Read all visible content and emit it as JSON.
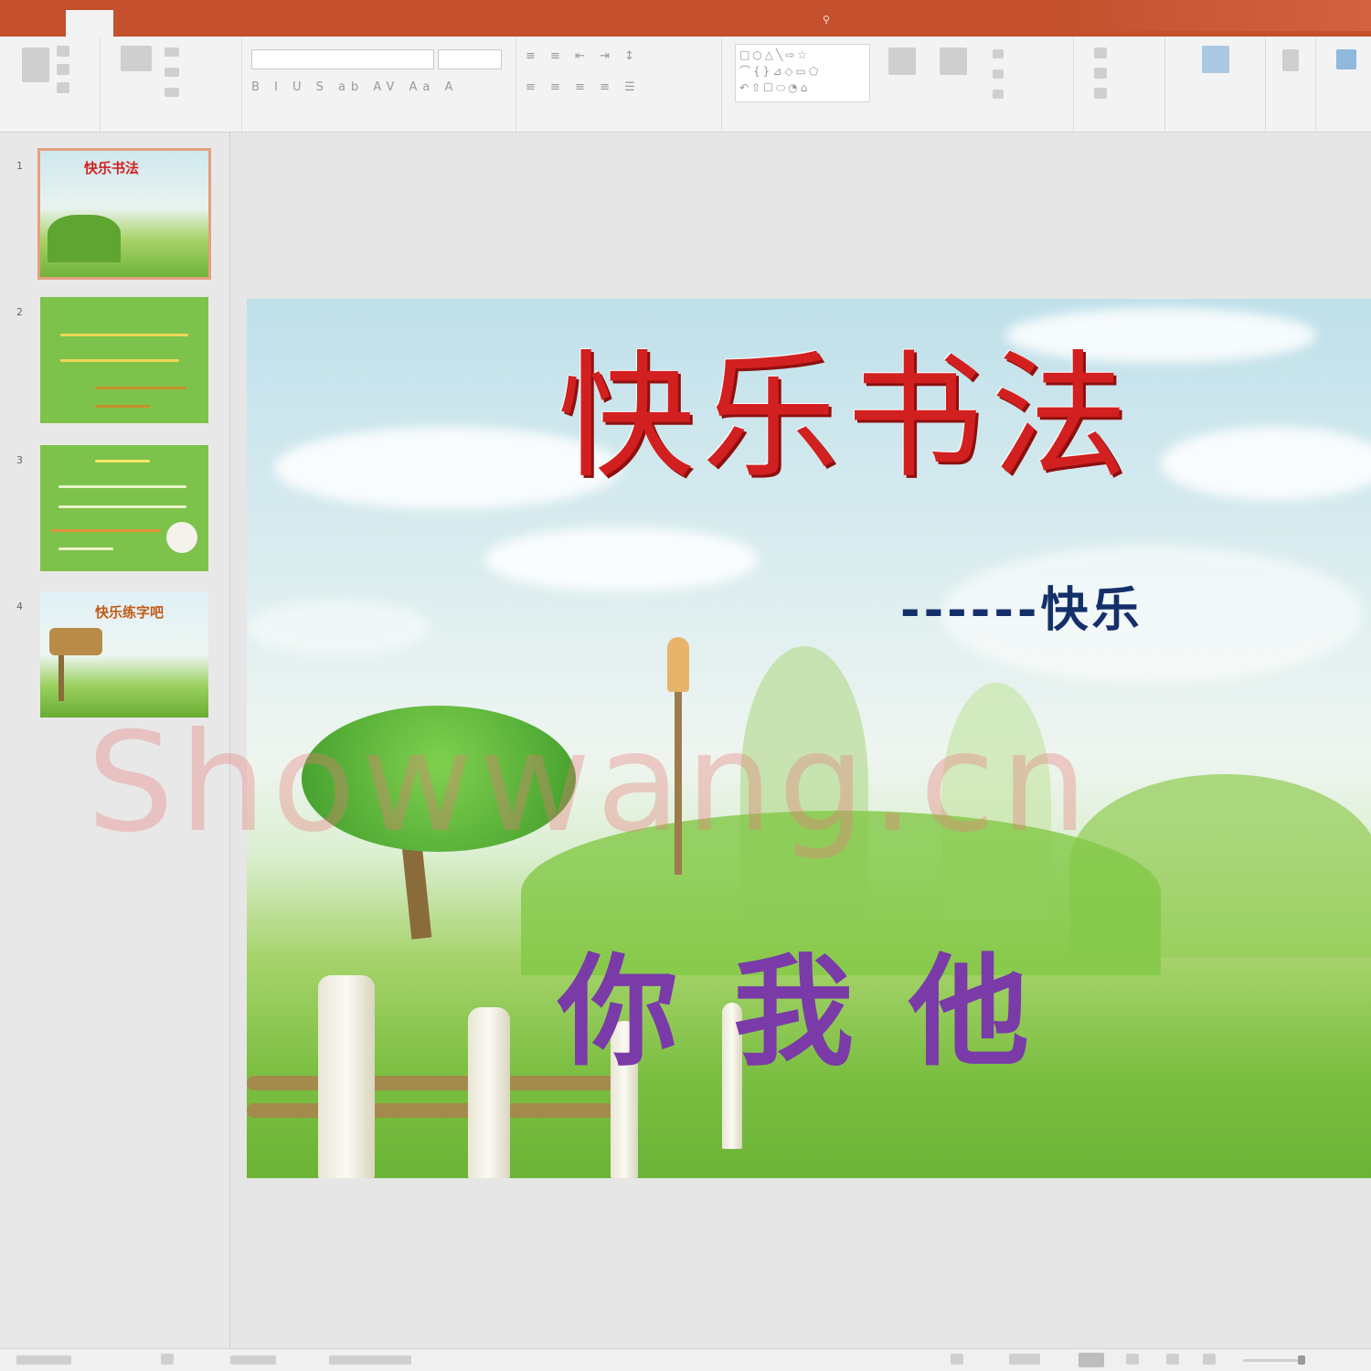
{
  "slide": {
    "title": "快乐书法",
    "subtitle": "------快乐",
    "pronouns": "你我他"
  },
  "thumbnails": [
    {
      "num": "1",
      "title": "快乐书法"
    },
    {
      "num": "2",
      "title": ""
    },
    {
      "num": "3",
      "title": ""
    },
    {
      "num": "4",
      "title": "快乐练字吧"
    }
  ],
  "watermark": "Showwang.cn",
  "colors": {
    "tabbar": "#c4502d",
    "title_red": "#d22020",
    "subtitle_navy": "#14306b",
    "pronoun_purple": "#7a3aa8",
    "thumb_green": "#7dc24b"
  },
  "icons": [
    "paste-icon",
    "new-slide-icon",
    "arrange-icon",
    "find-icon",
    "share-icon"
  ]
}
